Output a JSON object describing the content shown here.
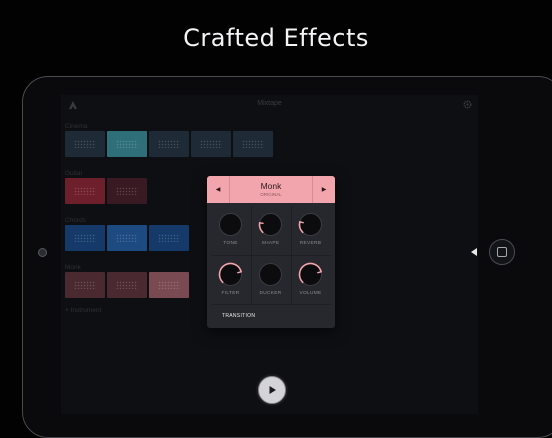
{
  "headline": "Crafted Effects",
  "app": {
    "title": "Mixtape",
    "add_instrument": "+ Instrument"
  },
  "tracks": [
    {
      "label": "Cinema",
      "cells": [
        "#1e2a36",
        "#2f6f7a",
        "#1e2a36",
        "#1e2a36",
        "#1e2a36",
        "#0e0f12"
      ]
    },
    {
      "label": "Guitar",
      "cells": [
        "#6e1f2c",
        "#3a1a22",
        "#0e0f12",
        "#0e0f12",
        "#0e0f12",
        "#0e0f12"
      ]
    },
    {
      "label": "Chords",
      "cells": [
        "#153a6a",
        "#1e4a82",
        "#153a6a",
        "#0e0f12",
        "#0e0f12",
        "#0e0f12"
      ]
    },
    {
      "label": "Monk",
      "cells": [
        "#4a2a30",
        "#4a2a30",
        "#7a4a52",
        "#0e0f12",
        "#0e0f12",
        "#0e0f12"
      ]
    }
  ],
  "effects": {
    "preset_name": "Monk",
    "preset_sub": "ORIGINAL",
    "prev_label": "◀",
    "next_label": "▶",
    "knobs": [
      {
        "label": "TONE",
        "value": 0.0
      },
      {
        "label": "SHAPE",
        "value": 0.2
      },
      {
        "label": "REVERB",
        "value": 0.22
      },
      {
        "label": "FILTER",
        "value": 0.78
      },
      {
        "label": "DUCKER",
        "value": 0.0
      },
      {
        "label": "VOLUME",
        "value": 0.78
      }
    ],
    "transition_label": "TRANSITION"
  },
  "colors": {
    "accent": "#f3a5ad",
    "knob_track": "#0c0c0e"
  }
}
